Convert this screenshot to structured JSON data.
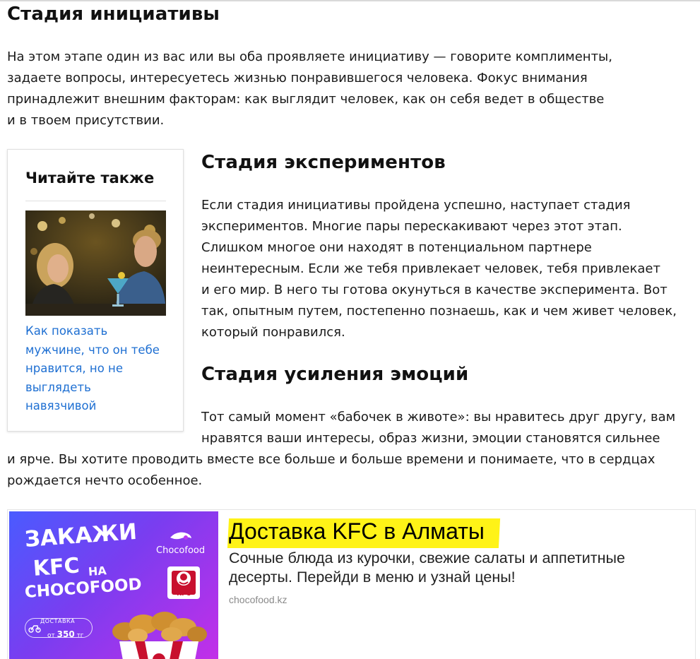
{
  "sections": [
    {
      "title": "Стадия инициативы",
      "lines": [
        "На этом этапе один из вас или вы оба проявляете инициативу — говорите комплименты,",
        "задаете вопросы, интересуетесь жизнью понравившегося человека. Фокус внимания",
        "принадлежит внешним факторам: как выглядит человек, как он себя ведет в обществе",
        "и в твоем присутствии."
      ]
    },
    {
      "title": "Стадия экспериментов",
      "lines": [
        "Если стадия инициативы пройдена успешно, наступает стадия",
        "экспериментов. Многие пары перескакивают через этот этап.",
        "Слишком многое они находят в потенциальном партнере",
        "неинтересным. Если же тебя привлекает человек, тебя привлекает",
        "и его мир. В него ты готова окунуться в качестве эксперимента. Вот",
        "так, опытным путем, постепенно познаешь, как и чем живет человек,",
        "который понравился."
      ]
    },
    {
      "title": "Стадия усиления эмоций",
      "lines": [
        "Тот самый момент «бабочек в животе»: вы нравитесь друг другу, вам",
        "нравятся ваши интересы, образ жизни, эмоции становятся сильнее",
        "и ярче. Вы хотите проводить вместе все больше и больше времени и понимаете, что в сердцах",
        "рождается нечто особенное."
      ]
    }
  ],
  "read_also": {
    "title": "Читайте также",
    "link_lines": [
      "Как показать",
      "мужчине, что он тебе",
      "нравится, но не",
      "выглядеть",
      "навязчивой"
    ]
  },
  "ad": {
    "banner": {
      "line1": "ЗАКАЖИ",
      "line2": "KFC",
      "line2_small": "НА",
      "line3": "CHOCOFOOD",
      "brand": "Chocofood",
      "kfc_label": "KFC",
      "delivery_label": "ДОСТАВКА",
      "price_prefix": "от",
      "price_value": "350",
      "price_currency": "тг"
    },
    "title": "Доставка KFC в Алматы",
    "description_lines": [
      "Сочные блюда из курочки, свежие салаты и аппетитные",
      "десерты. Перейди в меню и узнай цены!"
    ],
    "domain": "chocofood.kz"
  },
  "colors": {
    "link": "#1e6fd2",
    "highlight": "#fff317",
    "kfc_red": "#c8102e"
  }
}
